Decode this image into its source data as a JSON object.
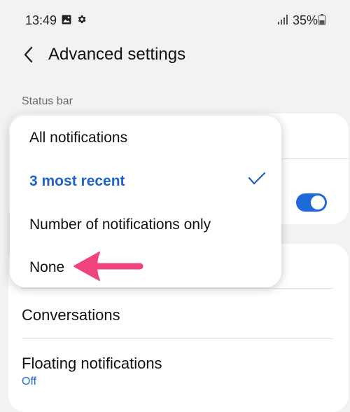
{
  "status_bar": {
    "time": "13:49",
    "battery_percent": "35%",
    "icons": [
      "gallery-icon",
      "gear-icon",
      "signal-icon",
      "battery-icon"
    ]
  },
  "header": {
    "title": "Advanced settings",
    "back_icon": "back-arrow-icon"
  },
  "section_label": "Status bar",
  "popup": {
    "options": [
      {
        "label": "All notifications",
        "selected": false
      },
      {
        "label": "3 most recent",
        "selected": true
      },
      {
        "label": "Number of notifications only",
        "selected": false
      },
      {
        "label": "None",
        "selected": false
      }
    ]
  },
  "toggle": {
    "on": true
  },
  "list": {
    "conversations": {
      "title": "Conversations"
    },
    "floating": {
      "title": "Floating notifications",
      "value": "Off"
    }
  },
  "colors": {
    "accent": "#1f6ad8",
    "selected_text": "#1f63c6",
    "annotation_arrow": "#f0447f",
    "background": "#f2f2f2"
  }
}
